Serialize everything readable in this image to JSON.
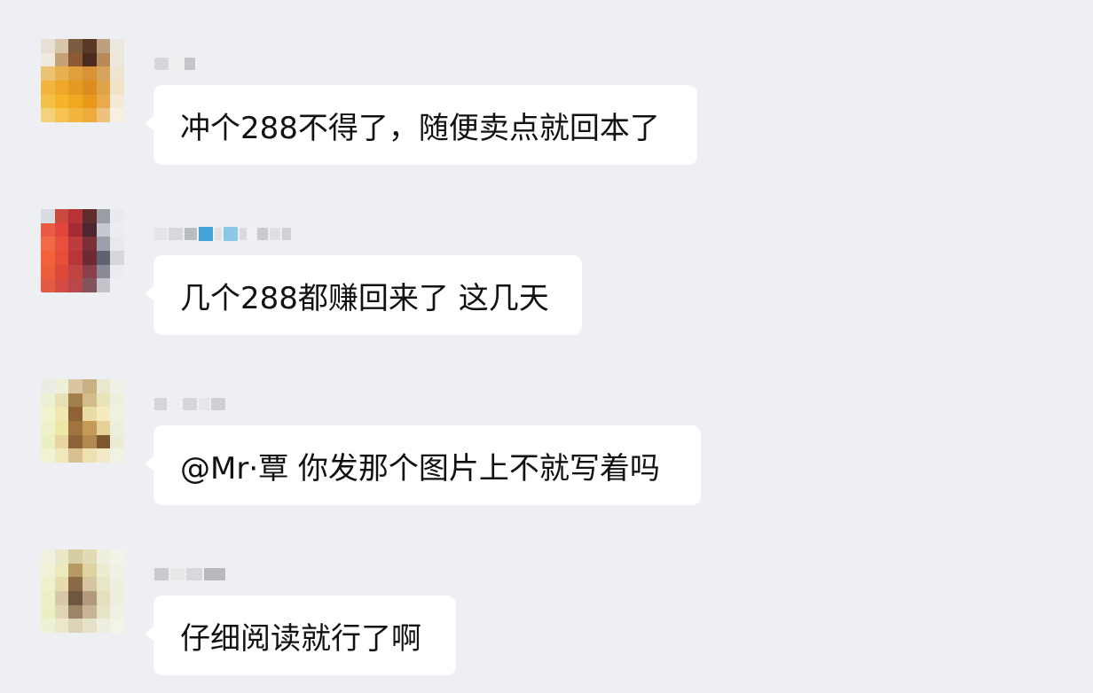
{
  "chat": {
    "messages": [
      {
        "text": "冲个288不得了，随便卖点就回本了",
        "avatar": {
          "label": "blurred-avatar",
          "colors": [
            "#e8e0d5",
            "#d8c7aa",
            "#7c5b3f",
            "#5a3827",
            "#bca080",
            "#ece8e0",
            "#efe9df",
            "#c7a176",
            "#8d5a33",
            "#4b2a20",
            "#b98a59",
            "#eee7dc",
            "#ebc372",
            "#e9b04f",
            "#e0a13b",
            "#d99235",
            "#d6a45c",
            "#efe4d0",
            "#f1b63f",
            "#f0a82b",
            "#e69a22",
            "#dd8c1f",
            "#e0a34a",
            "#f2e3c7",
            "#f3c14a",
            "#f5b42c",
            "#f0a81f",
            "#e8991b",
            "#eaa94c",
            "#f5ead8",
            "#f4d27c",
            "#f5c453",
            "#f2b63f",
            "#eeab39",
            "#edc27f",
            "#f7efe2"
          ]
        },
        "name_blur": [
          "#d7d7da",
          "#eeeeef",
          "#c6c6ca"
        ]
      },
      {
        "text": "几个288都赚回来了 这几天",
        "avatar": {
          "label": "blurred-avatar",
          "colors": [
            "#d8dde2",
            "#cb493d",
            "#b73337",
            "#5f2b2c",
            "#9b9da6",
            "#ebebee",
            "#eb5a45",
            "#e2453d",
            "#a62c34",
            "#4c2630",
            "#c5c9d1",
            "#ecedf1",
            "#f06a48",
            "#e84f3e",
            "#bf3b3d",
            "#7d2f38",
            "#9aa0ac",
            "#e8eaee",
            "#f1623b",
            "#e64e38",
            "#b8353a",
            "#6e2933",
            "#5f6270",
            "#d5d7dd",
            "#ee5e3b",
            "#dd4939",
            "#c14341",
            "#8a3f4b",
            "#8a8a96",
            "#ececf0",
            "#e45b43",
            "#d34b43",
            "#b84849",
            "#84545c",
            "#c2c3cb",
            "#efeff2"
          ]
        },
        "name_blur": [
          "#e5e5e7",
          "#d8d8dc",
          "#b9bcc1",
          "#44a3d6",
          "#dfe1e4",
          "#8fc6e3",
          "#d9dade",
          "#f0f0f2",
          "#c9cacd",
          "#e1e1e4",
          "#d0d0d3"
        ]
      },
      {
        "text": "@Mr·覃 你发那个图片上不就写着吗",
        "avatar": {
          "label": "blurred-avatar",
          "colors": [
            "#ebece4",
            "#eef1d8",
            "#d7c6a1",
            "#c9b082",
            "#e9e7cd",
            "#f0f0e7",
            "#ecf1d6",
            "#e7e0b6",
            "#a37f4c",
            "#d3bb8b",
            "#e8e3b9",
            "#eef0de",
            "#eff4cf",
            "#f0e7b1",
            "#8e6234",
            "#e9dca4",
            "#f5ebbe",
            "#f0f1dc",
            "#edf2c9",
            "#efe7a8",
            "#a07340",
            "#c49a59",
            "#e6d296",
            "#eeefdb",
            "#e9f0c3",
            "#e8d49e",
            "#8c6336",
            "#b3894f",
            "#7d5630",
            "#ecebd5",
            "#eff3d3",
            "#efe8bd",
            "#d8c090",
            "#ede1b1",
            "#f2e9c6",
            "#f1f2e4"
          ]
        },
        "name_blur": [
          "#d4d5d9",
          "#eeeef0",
          "#d5d6da",
          "#e6e6e8",
          "#cfd0d4"
        ]
      },
      {
        "text": "仔细阅读就行了啊",
        "avatar": {
          "label": "blurred-avatar",
          "colors": [
            "#eff0df",
            "#e8e8c8",
            "#d6cda1",
            "#e1dab4",
            "#eeefdc",
            "#f2f2e8",
            "#eff2d6",
            "#ece9bf",
            "#b79a63",
            "#ded2a3",
            "#ebecd0",
            "#f0f0e4",
            "#eef1cb",
            "#e6dcb0",
            "#8a6a47",
            "#d6c6a0",
            "#e8e6c6",
            "#eef0df",
            "#ecf0c4",
            "#d7c8a6",
            "#6f5642",
            "#b49a7c",
            "#e4dfbf",
            "#edeedd",
            "#eaf0c2",
            "#e0d5b4",
            "#9d8466",
            "#c8b596",
            "#e7e4c8",
            "#f0f1e3",
            "#eef2d4",
            "#eae8c8",
            "#dcd3b7",
            "#e5e1c7",
            "#eeeedf",
            "#f3f3ea"
          ]
        },
        "name_blur": [
          "#c9cacd",
          "#e6e6e8",
          "#d8d8db",
          "#b8babf"
        ]
      }
    ]
  }
}
